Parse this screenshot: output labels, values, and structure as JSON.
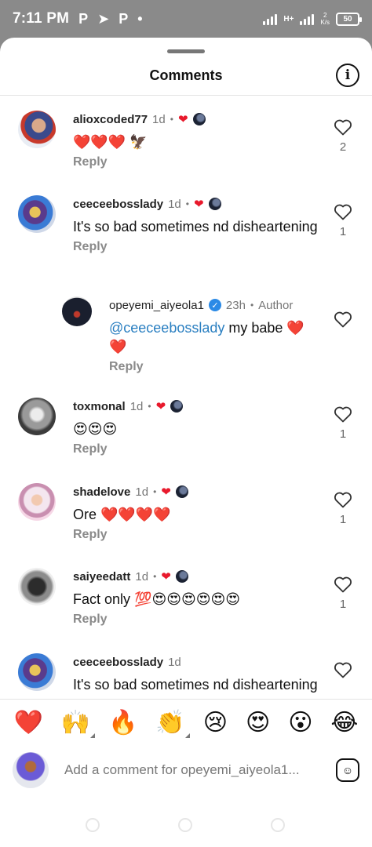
{
  "status_bar": {
    "time": "7:11 PM",
    "apps": [
      "P",
      "➤",
      "P",
      "•"
    ],
    "network": "H+",
    "speed": "2\nK/s",
    "battery": "50"
  },
  "sheet": {
    "title": "Comments",
    "info_icon": "info-icon"
  },
  "comments": [
    {
      "user": "alioxcoded77",
      "time": "1d",
      "text": "❤️❤️❤️ 🦅",
      "reply": "Reply",
      "likes": "2",
      "liked_by_author": true
    },
    {
      "user": "ceeceebosslady",
      "time": "1d",
      "text": "It's so bad sometimes nd disheartening",
      "reply": "Reply",
      "likes": "1",
      "liked_by_author": true
    },
    {
      "user": "opeyemi_aiyeola1",
      "time": "23h",
      "author_label": "Author",
      "mention": "@ceeceebosslady",
      "text": " my babe ❤️❤️",
      "reply": "Reply",
      "likes": "",
      "is_reply": true,
      "verified": true
    },
    {
      "user": "toxmonal",
      "time": "1d",
      "text": "😍😍😍",
      "reply": "Reply",
      "likes": "1",
      "liked_by_author": true
    },
    {
      "user": "shadelove",
      "time": "1d",
      "text": "Ore ❤️❤️❤️❤️",
      "reply": "Reply",
      "likes": "1",
      "liked_by_author": true
    },
    {
      "user": "saiyeedatt",
      "time": "1d",
      "text": "Fact only 💯😍😍😍😍😍😍",
      "reply": "Reply",
      "likes": "1",
      "liked_by_author": true
    },
    {
      "user": "ceeceebosslady",
      "time": "1d",
      "text": "It's so bad sometimes nd disheartening",
      "reply": "",
      "likes": ""
    }
  ],
  "reactions": [
    "❤️",
    "🙌",
    "🔥",
    "👏",
    "😢",
    "😍",
    "😮",
    "😂"
  ],
  "compose": {
    "placeholder": "Add a comment for opeyemi_aiyeola1...",
    "sticker_icon": "sticker-icon"
  },
  "colors": {
    "accent_heart": "#e8192c",
    "mention": "#2a7fc1",
    "verified": "#2b8ae6"
  }
}
